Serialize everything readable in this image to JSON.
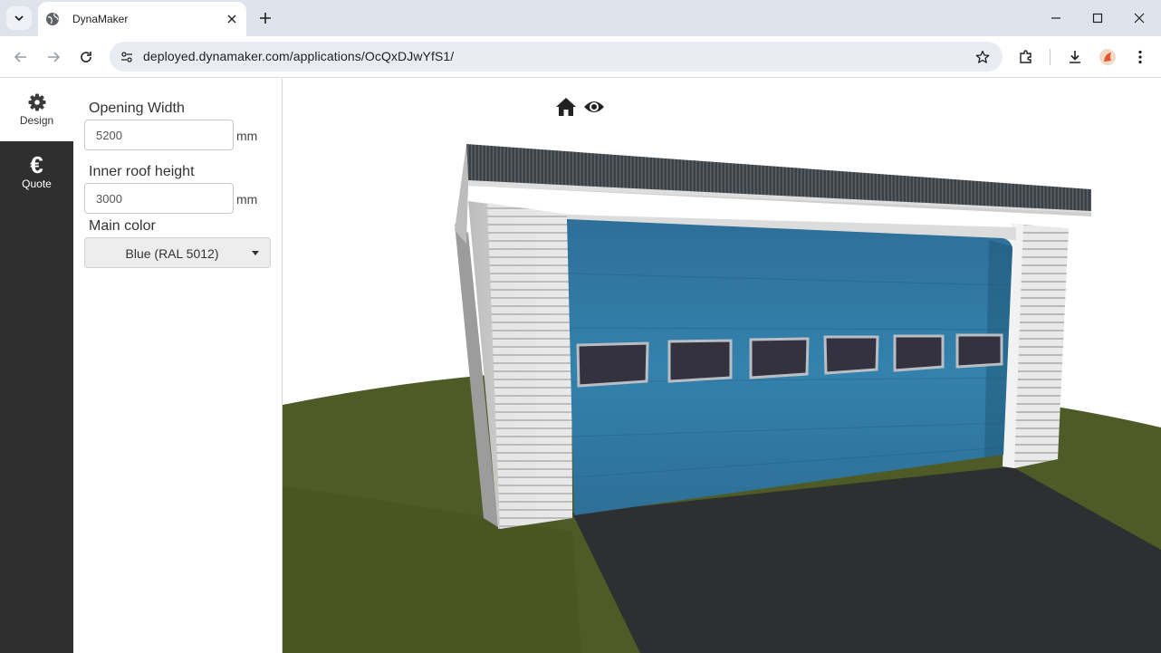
{
  "browser": {
    "tab_title": "DynaMaker",
    "url": "deployed.dynamaker.com/applications/OcQxDJwYfS1/"
  },
  "sidenav": {
    "items": [
      {
        "label": "Design",
        "icon": "gear-icon"
      },
      {
        "label": "Quote",
        "icon": "euro-icon"
      }
    ]
  },
  "form": {
    "opening_width": {
      "label": "Opening Width",
      "value": "5200",
      "unit": "mm"
    },
    "inner_roof_height": {
      "label": "Inner roof height",
      "value": "3000",
      "unit": "mm"
    },
    "main_color": {
      "label": "Main color",
      "value": "Blue (RAL 5012)"
    }
  },
  "colors": {
    "sidenav_bg": "#2f2f2f",
    "door_blue": "#2f7aa6",
    "grass": "#4d5a26",
    "asphalt": "#2e2f30",
    "wall": "#e2e2e2",
    "roof": "#3a3f44"
  }
}
